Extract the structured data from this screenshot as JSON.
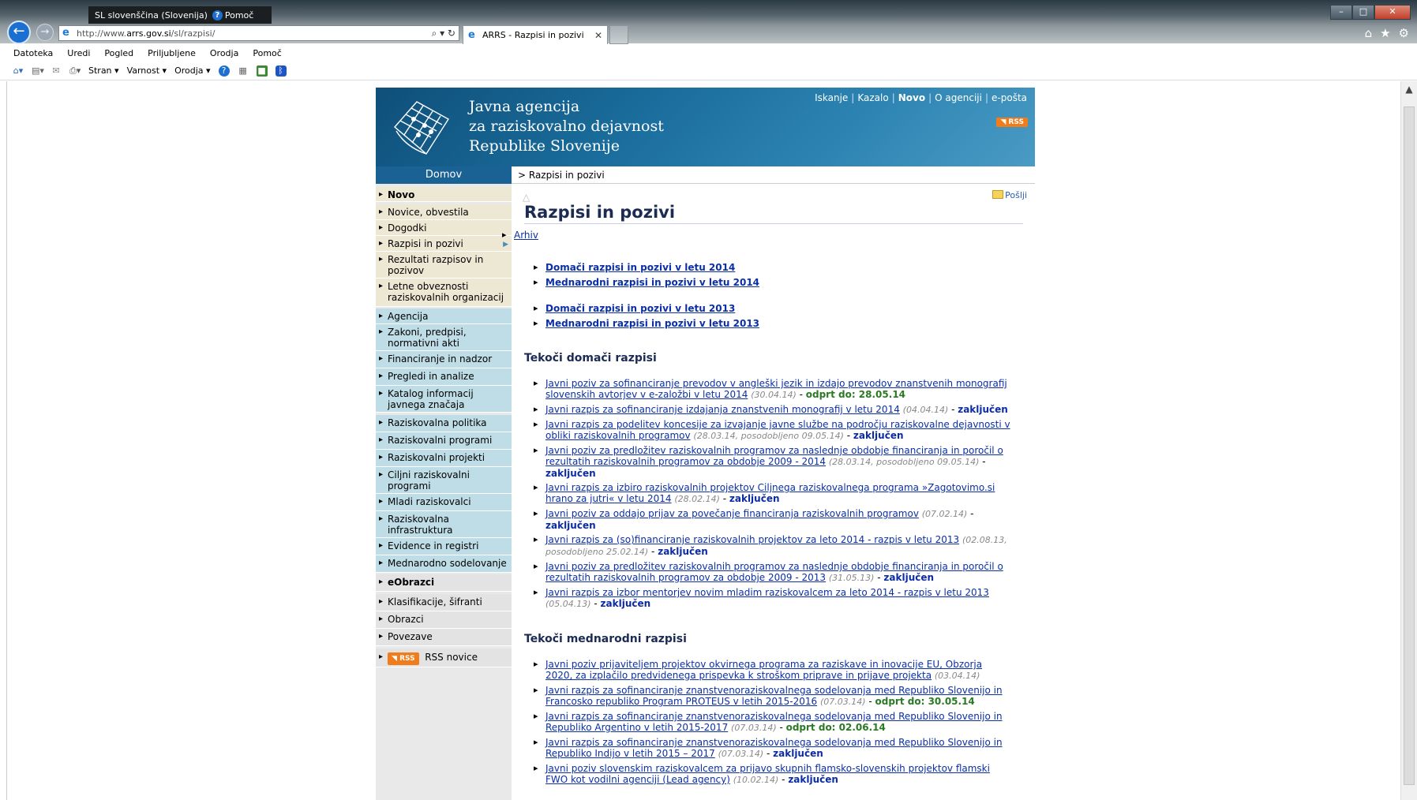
{
  "browser": {
    "language": "SL slovenščina (Slovenija)",
    "help": "Pomoč",
    "url_prefix": "http://www.",
    "url_domain": "arrs.gov.si",
    "url_path": "/sl/razpisi/",
    "tab_title": "ARRS - Razpisi in pozivi",
    "menu": [
      "Datoteka",
      "Uredi",
      "Pogled",
      "Priljubljene",
      "Orodja",
      "Pomoč"
    ],
    "cmd": {
      "page": "Stran",
      "safety": "Varnost",
      "tools": "Orodja"
    }
  },
  "header": {
    "title_lines": [
      "Javna agencija",
      "za raziskovalno dejavnost",
      "Republike Slovenije"
    ],
    "toplinks": [
      "Iskanje",
      "Kazalo",
      "Novo",
      "O agenciji",
      "e-pošta"
    ],
    "rss": "RSS"
  },
  "nav": {
    "home": "Domov",
    "breadcrumb": "> Razpisi in pozivi",
    "items": [
      "Novo",
      "Novice, obvestila",
      "Dogodki",
      "Razpisi in pozivi",
      "Rezultati razpisov in pozivov",
      "Letne obveznosti raziskovalnih organizacij",
      "Agencija",
      "Zakoni, predpisi, normativni akti",
      "Financiranje in nadzor",
      "Pregledi in analize",
      "Katalog informacij javnega značaja",
      "Raziskovalna politika",
      "Raziskovalni programi",
      "Raziskovalni projekti",
      "Ciljni raziskovalni programi",
      "Mladi raziskovalci",
      "Raziskovalna infrastruktura",
      "Evidence in registri",
      "Mednarodno sodelovanje",
      "eObrazci",
      "Klasifikacije, šifranti",
      "Obrazci",
      "Povezave",
      "RSS novice"
    ]
  },
  "main": {
    "poslji": "Pošlji",
    "title": "Razpisi in pozivi",
    "archive": "Arhiv",
    "year_links": [
      "Domači razpisi in pozivi v letu 2014",
      "Mednarodni razpisi in pozivi v letu 2014",
      "Domači razpisi in pozivi v letu 2013",
      "Mednarodni razpisi in pozivi v letu 2013"
    ],
    "domestic_heading": "Tekoči domači razpisi",
    "domestic": [
      {
        "link": "Javni poziv za sofinanciranje prevodov v angleški jezik in izdajo prevodov znanstvenih monografij slovenskih avtorjev v e-založbi v letu 2014",
        "meta": "(30.04.14)",
        "status": "odprt do: 28.05.14"
      },
      {
        "link": "Javni razpis za sofinanciranje izdajanja znanstvenih monografij v letu 2014",
        "meta": "(04.04.14)",
        "status": "zaključen"
      },
      {
        "link": "Javni razpis za podelitev koncesije za izvajanje javne službe na področju raziskovalne dejavnosti v obliki raziskovalnih programov",
        "meta": "(28.03.14, posodobljeno 09.05.14)",
        "status": "zaključen"
      },
      {
        "link": "Javni poziv za predložitev raziskovalnih programov za naslednje obdobje financiranja in poročil o rezultatih raziskovalnih programov za obdobje 2009 - 2014",
        "meta": "(28.03.14, posodobljeno 09.05.14)",
        "status": "zaključen"
      },
      {
        "link": "Javni razpis za izbiro raziskovalnih projektov Ciljnega raziskovalnega programa »Zagotovimo.si hrano za jutri« v letu 2014",
        "meta": "(28.02.14)",
        "status": "zaključen"
      },
      {
        "link": "Javni poziv za oddajo prijav za povečanje financiranja raziskovalnih programov",
        "meta": "(07.02.14)",
        "status": "zaključen"
      },
      {
        "link": "Javni razpis za (so)financiranje raziskovalnih projektov za leto 2014 - razpis v letu 2013",
        "meta": "(02.08.13, posodobljeno 25.02.14)",
        "status": "zaključen"
      },
      {
        "link": "Javni poziv za predložitev raziskovalnih programov za naslednje obdobje financiranja in poročil o rezultatih raziskovalnih programov za obdobje 2009 - 2013",
        "meta": "(31.05.13)",
        "status": "zaključen"
      },
      {
        "link": "Javni razpis za izbor mentorjev novim mladim raziskovalcem za leto 2014 - razpis v letu 2013",
        "meta": "(05.04.13)",
        "status": "zaključen"
      }
    ],
    "intl_heading": "Tekoči mednarodni razpisi",
    "intl": [
      {
        "link": "Javni poziv prijaviteljem projektov okvirnega programa za raziskave in inovacije EU, Obzorja 2020, za izplačilo predvidenega prispevka k stroškom priprave in prijave projekta",
        "meta": "(03.04.14)",
        "status": ""
      },
      {
        "link": "Javni razpis za sofinanciranje znanstvenoraziskovalnega sodelovanja med Republiko Slovenijo in Francosko republiko Program PROTEUS v letih 2015-2016",
        "meta": "(07.03.14)",
        "status": "odprt do: 30.05.14"
      },
      {
        "link": "Javni razpis za sofinanciranje znanstvenoraziskovalnega sodelovanja med Republiko Slovenijo in Republiko Argentino v letih 2015-2017",
        "meta": "(07.03.14)",
        "status": "odprt do: 02.06.14"
      },
      {
        "link": "Javni razpis za sofinanciranje znanstvenoraziskovalnega sodelovanja med Republiko Slovenijo in Republiko Indijo v letih 2015 – 2017",
        "meta": "(07.03.14)",
        "status": "zaključen"
      },
      {
        "link": "Javni poziv slovenskim raziskovalcem za prijavo skupnih flamsko-slovenskih projektov flamski FWO kot vodilni agenciji (Lead agency)",
        "meta": "(10.02.14)",
        "status": "zaključen"
      }
    ]
  }
}
